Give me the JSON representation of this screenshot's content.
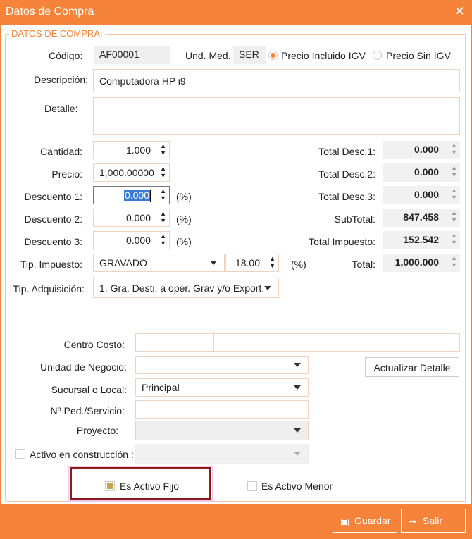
{
  "window": {
    "title": "Datos de Compra",
    "close_glyph": "✕"
  },
  "legend": "DATOS DE COMPRA:",
  "codigo": {
    "label": "Código:",
    "value": "AF00001"
  },
  "und_med": {
    "label": "Und. Med.",
    "value": "SER"
  },
  "precio_tipo": {
    "incluido": "Precio Incluido IGV",
    "sin": "Precio Sin IGV",
    "selected": "incluido"
  },
  "descripcion": {
    "label": "Descripción:",
    "value": "Computadora HP i9"
  },
  "detalle": {
    "label": "Detalle:",
    "value": ""
  },
  "cantidad": {
    "label": "Cantidad:",
    "value": "1.000"
  },
  "precio": {
    "label": "Precio:",
    "value": "1,000.00000"
  },
  "descuento1": {
    "label": "Descuento 1:",
    "value": "0.000",
    "unit": "(%)"
  },
  "descuento2": {
    "label": "Descuento 2:",
    "value": "0.000",
    "unit": "(%)"
  },
  "descuento3": {
    "label": "Descuento 3:",
    "value": "0.000",
    "unit": "(%)"
  },
  "tip_impuesto": {
    "label": "Tip. Impuesto:",
    "value": "GRAVADO",
    "rate": "18.00",
    "unit": "(%)"
  },
  "tip_adquisicion": {
    "label": "Tip. Adquisición:",
    "value": "1. Gra. Desti. a oper. Grav y/o Export."
  },
  "totals": {
    "desc1": {
      "label": "Total Desc.1:",
      "value": "0.000"
    },
    "desc2": {
      "label": "Total Desc.2:",
      "value": "0.000"
    },
    "desc3": {
      "label": "Total Desc.3:",
      "value": "0.000"
    },
    "subtotal": {
      "label": "SubTotal:",
      "value": "847.458"
    },
    "impuesto": {
      "label": "Total Impuesto:",
      "value": "152.542"
    },
    "total": {
      "label": "Total:",
      "value": "1,000.000"
    }
  },
  "centro_costo": {
    "label": "Centro Costo:",
    "code": "",
    "name": ""
  },
  "unidad_negocio": {
    "label": "Unidad de Negocio:",
    "value": ""
  },
  "actualizar_detalle": "Actualizar Detalle",
  "sucursal": {
    "label": "Sucursal o Local:",
    "value": "Principal"
  },
  "ped_servicio": {
    "label": "Nº Ped./Servicio:",
    "value": ""
  },
  "proyecto": {
    "label": "Proyecto:",
    "value": ""
  },
  "activo_construccion": {
    "label": "Activo en construcción :",
    "checked": false,
    "value": ""
  },
  "es_activo_fijo": {
    "label": "Es Activo Fijo",
    "checked": true
  },
  "es_activo_menor": {
    "label": "Es Activo Menor",
    "checked": false
  },
  "footer": {
    "guardar": "Guardar",
    "salir": "Salir"
  },
  "colors": {
    "accent": "#f5843a",
    "highlight_box": "#8b1a1a"
  }
}
